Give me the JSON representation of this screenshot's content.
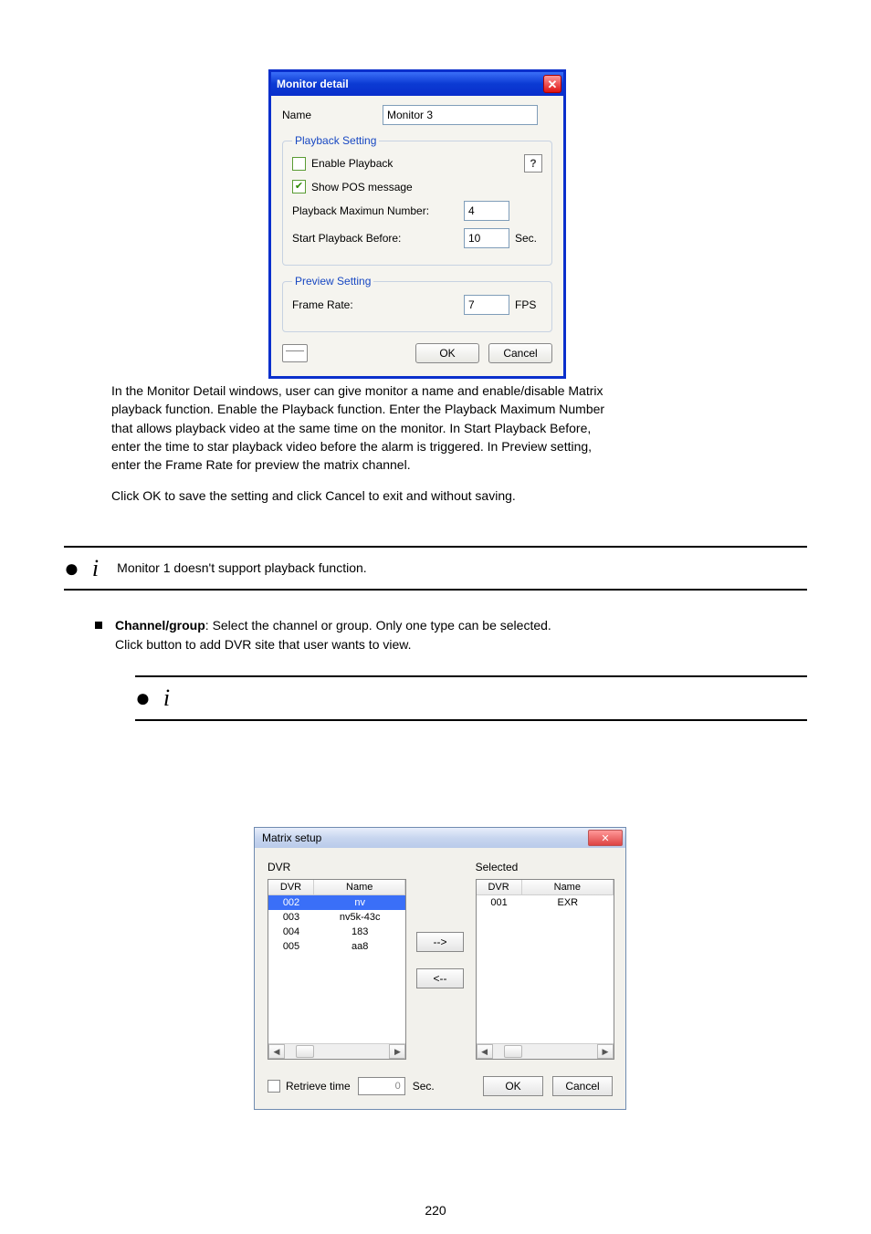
{
  "page_number": "220",
  "monitor_dialog": {
    "title": "Monitor detail",
    "name_label": "Name",
    "name_value": "Monitor 3",
    "playback": {
      "legend": "Playback Setting",
      "enable_label": "Enable Playback",
      "enable_checked": false,
      "help_label": "?",
      "show_pos_label": "Show POS message",
      "show_pos_checked": true,
      "max_num_label": "Playback Maximun Number:",
      "max_num_value": "4",
      "start_before_label": "Start Playback Before:",
      "start_before_value": "10",
      "start_before_unit": "Sec."
    },
    "preview": {
      "legend": "Preview Setting",
      "frame_rate_label": "Frame Rate:",
      "frame_rate_value": "7",
      "frame_rate_unit": "FPS"
    },
    "ok": "OK",
    "cancel": "Cancel"
  },
  "text_block": {
    "lines": [
      "In the Monitor Detail windows, user can give monitor a name and enable/disable Matrix",
      "playback function. Enable the Playback function. Enter the Playback Maximum Number",
      "that allows playback video at the same time on the monitor. In Start Playback Before,",
      "enter the time to star playback video before the alarm is triggered. In Preview setting,",
      "enter the Frame Rate for preview the matrix channel.",
      "Click OK to save the setting and click Cancel to exit and without saving."
    ],
    "info": "Monitor 1 doesn't support playback function.",
    "bullet_title": "Channel/group",
    "bullet_body1": "Select the channel or group. Only one type can be selected.",
    "bullet_body2": "Click   button to add DVR site that user wants to view."
  },
  "matrix_dialog": {
    "title": "Matrix setup",
    "dvr_label": "DVR",
    "selected_label": "Selected",
    "col_dvr": "DVR",
    "col_name": "Name",
    "left_rows": [
      {
        "dvr": "002",
        "name": "nv",
        "selected": true
      },
      {
        "dvr": "003",
        "name": "nv5k-43c",
        "selected": false
      },
      {
        "dvr": "004",
        "name": "183",
        "selected": false
      },
      {
        "dvr": "005",
        "name": "aa8",
        "selected": false
      }
    ],
    "right_rows": [
      {
        "dvr": "001",
        "name": "EXR",
        "selected": false
      }
    ],
    "arrow_right": "-->",
    "arrow_left": "<--",
    "retrieve_label": "Retrieve time",
    "retrieve_value": "0",
    "retrieve_unit": "Sec.",
    "ok": "OK",
    "cancel": "Cancel"
  }
}
